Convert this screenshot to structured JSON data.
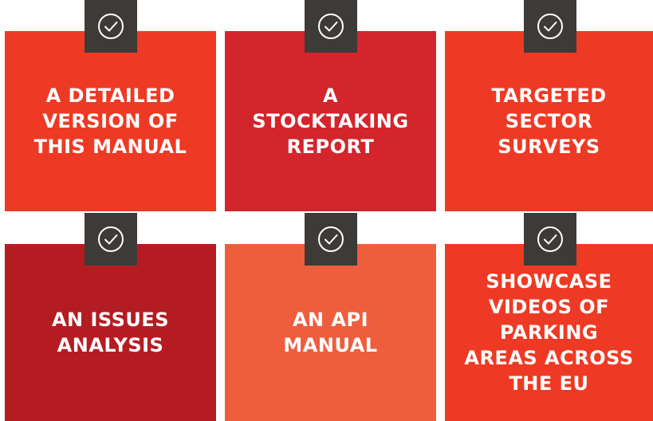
{
  "tiles": [
    {
      "label": "A DETAILED\nVERSION OF\nTHIS MANUAL",
      "color": "#ee3a24",
      "icon": "check-circle-icon"
    },
    {
      "label": "A\nSTOCKTAKING\nREPORT",
      "color": "#d4242c",
      "icon": "check-circle-icon"
    },
    {
      "label": "TARGETED\nSECTOR\nSURVEYS",
      "color": "#ee3a24",
      "icon": "check-circle-icon"
    },
    {
      "label": "AN ISSUES\nANALYSIS",
      "color": "#b51c22",
      "icon": "check-circle-icon"
    },
    {
      "label": "AN API\nMANUAL",
      "color": "#ee5e3d",
      "icon": "check-circle-icon"
    },
    {
      "label": "SHOWCASE\nVIDEOS OF\nPARKING\nAREAS ACROSS\nTHE EU",
      "color": "#ee3a24",
      "icon": "check-circle-icon"
    }
  ],
  "badge_color": "#3d3a38"
}
